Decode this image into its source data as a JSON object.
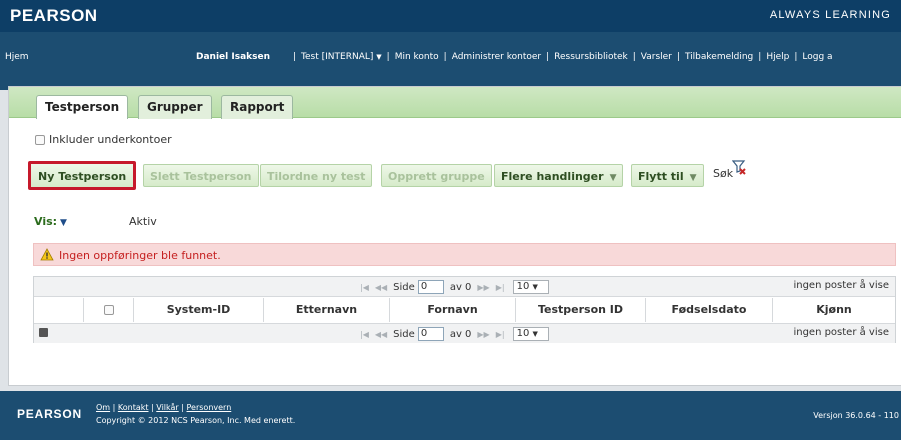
{
  "header": {
    "brand": "PEARSON",
    "tagline": "ALWAYS LEARNING"
  },
  "nav": {
    "home": "Hjem",
    "user": "Daniel Isaksen",
    "links": [
      "Test [INTERNAL]",
      "Min konto",
      "Administrer kontoer",
      "Ressursbibliotek",
      "Varsler",
      "Tilbakemelding",
      "Hjelp",
      "Logg a"
    ]
  },
  "tabs": [
    "Testperson",
    "Grupper",
    "Rapport"
  ],
  "include_subaccounts": "Inkluder underkontoer",
  "toolbar": {
    "new_testperson": "Ny Testperson",
    "delete_testperson": "Slett Testperson",
    "assign_test": "Tilordne ny test",
    "create_group": "Opprett gruppe",
    "more_actions": "Flere handlinger",
    "move_to": "Flytt til",
    "search": "Søk"
  },
  "view": {
    "label": "Vis:",
    "value": "Aktiv"
  },
  "alert": {
    "text": "Ingen oppføringer ble funnet."
  },
  "pager": {
    "page_label": "Side",
    "page_value": "0",
    "of_label": "av 0",
    "page_size": "10",
    "summary": "ingen poster å vise"
  },
  "columns": [
    "System-ID",
    "Etternavn",
    "Fornavn",
    "Testperson ID",
    "Fødselsdato",
    "Kjønn"
  ],
  "footer": {
    "brand": "PEARSON",
    "links": [
      "Om",
      "Kontakt",
      "Vilkår",
      "Personvern"
    ],
    "copyright": "Copyright © 2012 NCS Pearson, Inc. Med enerett.",
    "version": "Versjon 36.0.64 - 110"
  },
  "colors": {
    "brand_dark": "#0d3e66",
    "nav_blue": "#1c4d71",
    "tab_green": "#b8dda7",
    "highlight_red": "#c6192b",
    "alert_bg": "#f8d9d9"
  }
}
